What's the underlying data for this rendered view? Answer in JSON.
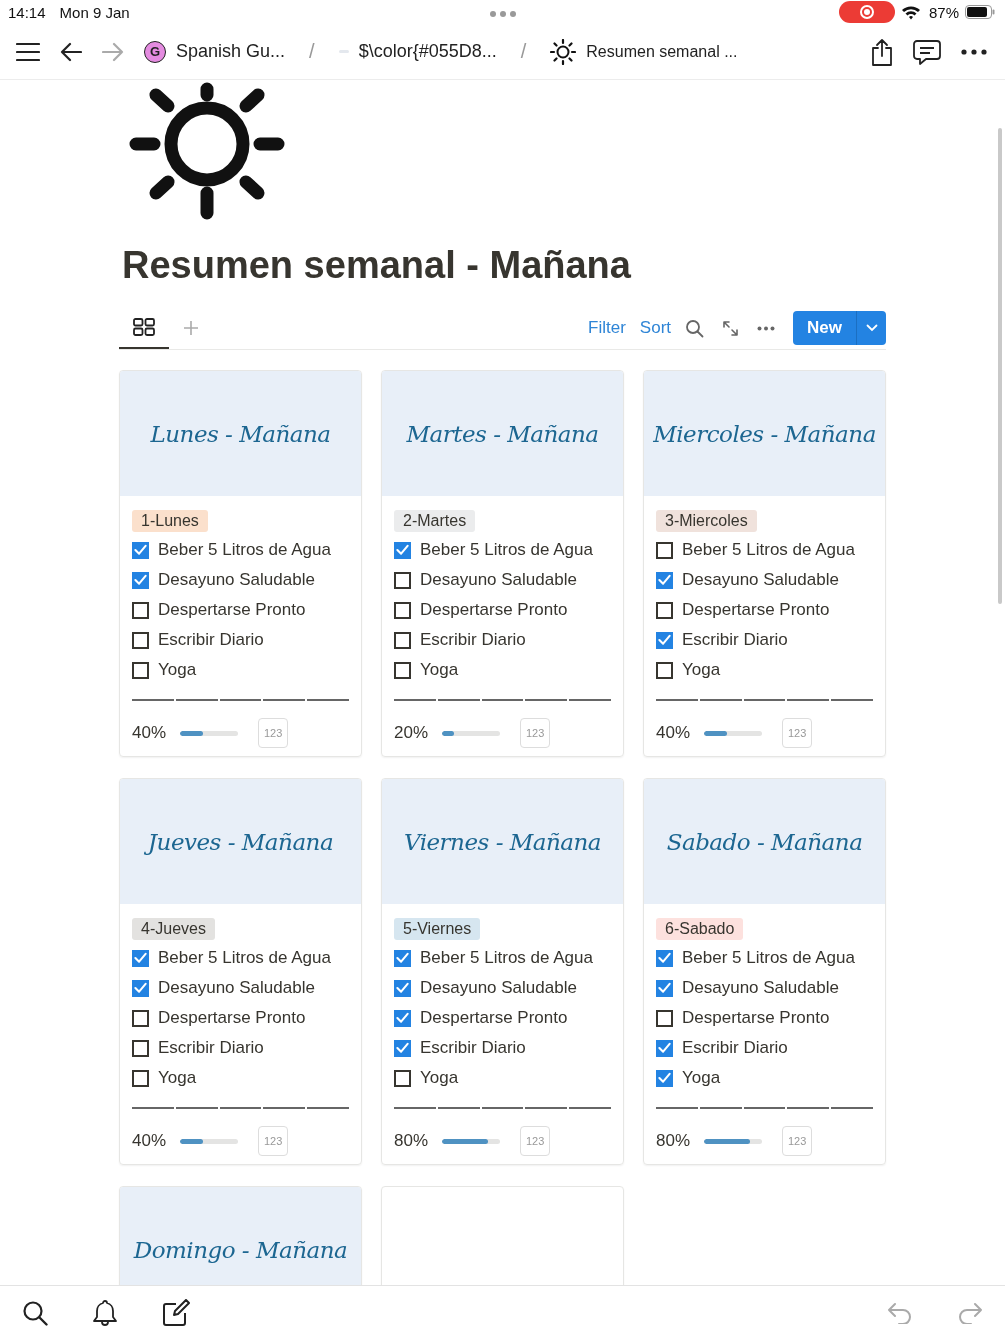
{
  "status_bar": {
    "time": "14:14",
    "date": "Mon 9 Jan",
    "battery": "87%"
  },
  "breadcrumbs": [
    {
      "kind": "avatar",
      "avatar": "G",
      "label": "Spanish Gu..."
    },
    {
      "kind": "blank",
      "separator": "/",
      "label": "$\\color{#055D8..."
    },
    {
      "kind": "sun",
      "separator": "/",
      "label": "Resumen semanal ..."
    }
  ],
  "page": {
    "title": "Resumen semanal - Mañana"
  },
  "toolbar": {
    "actions": [
      "Filter",
      "Sort"
    ],
    "new_button": "New"
  },
  "cards": [
    {
      "cover": "Lunes - Mañana",
      "tag": {
        "label": "1-Lunes",
        "color": "#fbe0cc"
      },
      "habits": [
        {
          "label": "Beber 5 Litros de Agua",
          "checked": true
        },
        {
          "label": "Desayuno Saludable",
          "checked": true
        },
        {
          "label": "Despertarse Pronto",
          "checked": false
        },
        {
          "label": "Escribir Diario",
          "checked": false
        },
        {
          "label": "Yoga",
          "checked": false
        }
      ],
      "progress": {
        "reading": "40%",
        "level": 0.4
      },
      "badge": "123"
    },
    {
      "cover": "Martes - Mañana",
      "tag": {
        "label": "2-Martes",
        "color": "#ebeced"
      },
      "habits": [
        {
          "label": "Beber 5 Litros de Agua",
          "checked": true
        },
        {
          "label": "Desayuno Saludable",
          "checked": false
        },
        {
          "label": "Despertarse Pronto",
          "checked": false
        },
        {
          "label": "Escribir Diario",
          "checked": false
        },
        {
          "label": "Yoga",
          "checked": false
        }
      ],
      "progress": {
        "reading": "20%",
        "level": 0.2
      },
      "badge": "123"
    },
    {
      "cover": "Miercoles - Mañana",
      "tag": {
        "label": "3-Miercoles",
        "color": "#f0e2dc"
      },
      "habits": [
        {
          "label": "Beber 5 Litros de Agua",
          "checked": false
        },
        {
          "label": "Desayuno Saludable",
          "checked": true
        },
        {
          "label": "Despertarse Pronto",
          "checked": false
        },
        {
          "label": "Escribir Diario",
          "checked": true
        },
        {
          "label": "Yoga",
          "checked": false
        }
      ],
      "progress": {
        "reading": "40%",
        "level": 0.4
      },
      "badge": "123"
    },
    {
      "cover": "Jueves - Mañana",
      "tag": {
        "label": "4-Jueves",
        "color": "#e3e2e0"
      },
      "habits": [
        {
          "label": "Beber 5 Litros de Agua",
          "checked": true
        },
        {
          "label": "Desayuno Saludable",
          "checked": true
        },
        {
          "label": "Despertarse Pronto",
          "checked": false
        },
        {
          "label": "Escribir Diario",
          "checked": false
        },
        {
          "label": "Yoga",
          "checked": false
        }
      ],
      "progress": {
        "reading": "40%",
        "level": 0.4
      },
      "badge": "123"
    },
    {
      "cover": "Viernes - Mañana",
      "tag": {
        "label": "5-Viernes",
        "color": "#d6e6f0"
      },
      "habits": [
        {
          "label": "Beber 5 Litros de Agua",
          "checked": true
        },
        {
          "label": "Desayuno Saludable",
          "checked": true
        },
        {
          "label": "Despertarse Pronto",
          "checked": true
        },
        {
          "label": "Escribir Diario",
          "checked": true
        },
        {
          "label": "Yoga",
          "checked": false
        }
      ],
      "progress": {
        "reading": "80%",
        "level": 0.8
      },
      "badge": "123"
    },
    {
      "cover": "Sabado - Mañana",
      "tag": {
        "label": "6-Sabado",
        "color": "#fde1de"
      },
      "habits": [
        {
          "label": "Beber 5 Litros de Agua",
          "checked": true
        },
        {
          "label": "Desayuno Saludable",
          "checked": true
        },
        {
          "label": "Despertarse Pronto",
          "checked": false
        },
        {
          "label": "Escribir Diario",
          "checked": true
        },
        {
          "label": "Yoga",
          "checked": true
        }
      ],
      "progress": {
        "reading": "80%",
        "level": 0.8
      },
      "badge": "123"
    },
    {
      "cover": "Domingo - Mañana"
    },
    {
      "kind": "blank"
    }
  ]
}
